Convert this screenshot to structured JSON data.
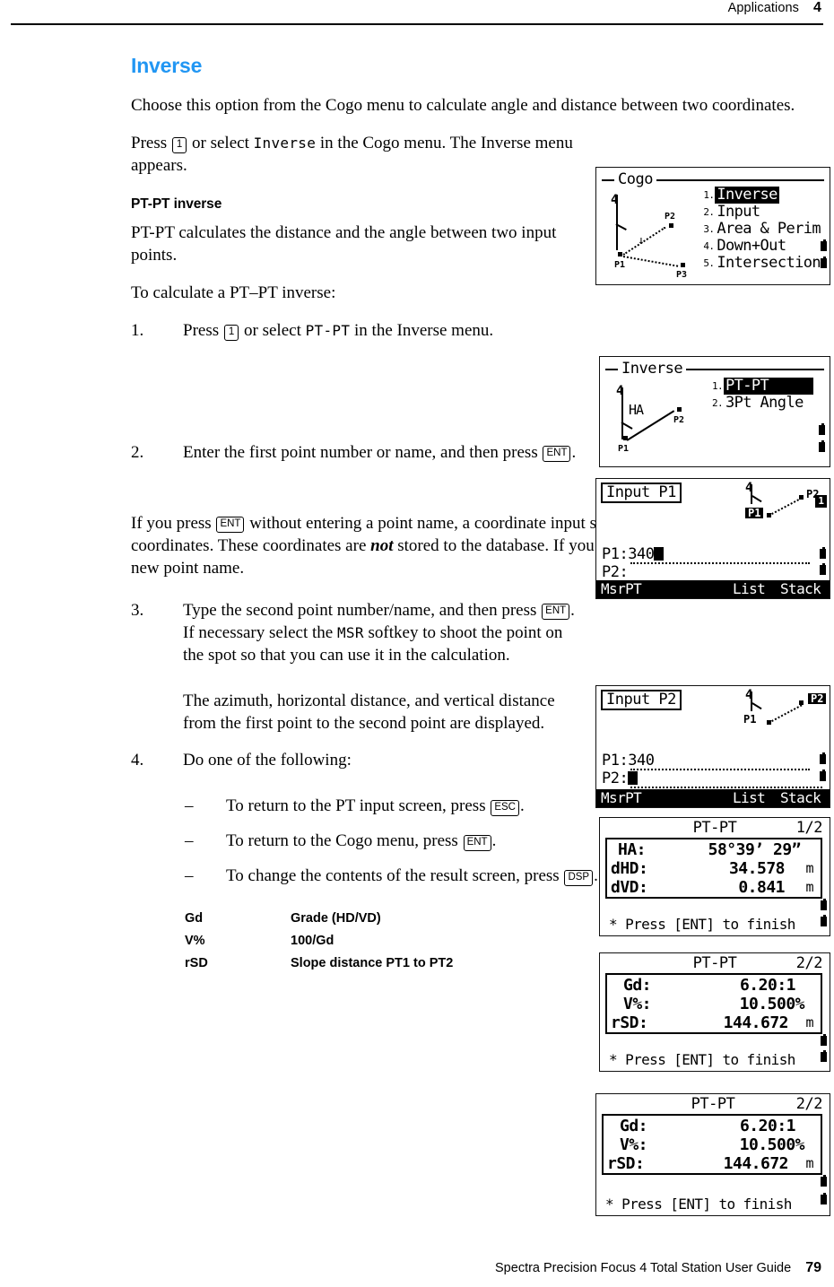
{
  "header": {
    "section": "Applications",
    "chapter": "4"
  },
  "footer": {
    "guide": "Spectra Precision Focus 4 Total Station User Guide",
    "page": "79"
  },
  "content": {
    "section_title": "Inverse",
    "intro": "Choose this option from the Cogo menu to calculate angle and distance between two coordinates.",
    "press_para_pre": "Press ",
    "press_para_key": "1",
    "press_para_mid": " or select ",
    "press_para_mono": "Inverse",
    "press_para_post": " in the Cogo menu. The Inverse menu appears.",
    "subsection_title": "PT-PT inverse",
    "ptpt_desc": "PT-PT calculates the distance and the angle between two input points.",
    "to_calc": "To calculate a PT–PT inverse:",
    "steps": [
      {
        "num": "1.",
        "pre": "Press ",
        "key": "1",
        "mid": " or select ",
        "mono": "PT-PT",
        "post": " in the Inverse menu."
      },
      {
        "num": "2.",
        "pre": "Enter the first point number or name, and then press ",
        "key": "ENT",
        "post": "."
      },
      {
        "num": "3.",
        "pre": "Type the second point number/name, and then press ",
        "key": "ENT",
        "mid": ". If necessary select the ",
        "mono": "MSR",
        "post": " softkey to shoot the point on the spot so that you can use it in the calculation."
      },
      {
        "num": "4.",
        "pre": "Do one of the following:"
      }
    ],
    "note_pre": "If you press ",
    "note_key": "ENT",
    "note_mid": " without entering a point name, a coordinate input screen appears, and you can enter coordinates. These coordinates are ",
    "note_bold": "not",
    "note_post": " stored to the database. If you want to store the point, specify a new point name.",
    "azimuth_note": "The azimuth, horizontal distance, and vertical distance from the first point to the second point are displayed.",
    "bullets": [
      {
        "dash": "–",
        "pre": "To return to the PT input screen, press ",
        "key": "ESC",
        "post": "."
      },
      {
        "dash": "–",
        "pre": "To return to the Cogo menu, press ",
        "key": "ENT",
        "post": "."
      },
      {
        "dash": "–",
        "pre": "To change the contents of the result screen, press ",
        "key": "DSP",
        "post": "."
      }
    ],
    "definitions": [
      {
        "term": "Gd",
        "desc": "Grade (HD/VD)"
      },
      {
        "term": "V%",
        "desc": "100/Gd"
      },
      {
        "term": "rSD",
        "desc": "Slope distance PT1 to PT2"
      }
    ]
  },
  "screens": {
    "cogo": {
      "frame_label": "Cogo",
      "items": [
        {
          "index": "1.",
          "label": "Inverse",
          "selected": true
        },
        {
          "index": "2.",
          "label": "Input",
          "selected": false
        },
        {
          "index": "3.",
          "label": "Area & Perim",
          "selected": false
        },
        {
          "index": "4.",
          "label": "Down+Out",
          "selected": false
        },
        {
          "index": "5.",
          "label": "Intersection",
          "selected": false
        }
      ],
      "diagram_points": [
        "P1",
        "P2",
        "P3"
      ]
    },
    "inverse": {
      "frame_label": "Inverse",
      "items": [
        {
          "index": "1.",
          "label": "PT-PT",
          "selected": true
        },
        {
          "index": "2.",
          "label": "3Pt Angle",
          "selected": false
        }
      ],
      "diagram_points": [
        "P1",
        "P2"
      ],
      "diagram_angle_label": "HA"
    },
    "input_p1": {
      "title": "Input P1",
      "rows": [
        {
          "label": "P1:",
          "value": "340",
          "cursor": true
        },
        {
          "label": "P2:",
          "value": "",
          "cursor": false
        }
      ],
      "softkeys": [
        "MsrPT",
        "List",
        "Stack"
      ],
      "diagram_points": [
        "P1",
        "P2"
      ],
      "mode_indicator": "1"
    },
    "input_p2": {
      "title": "Input P2",
      "rows": [
        {
          "label": "P1:",
          "value": "340",
          "cursor": false
        },
        {
          "label": "P2:",
          "value": "",
          "cursor": true
        }
      ],
      "softkeys": [
        "MsrPT",
        "List",
        "Stack"
      ],
      "diagram_points": [
        "P1",
        "P2"
      ]
    },
    "result_1": {
      "title": "PT-PT",
      "page": "1/2",
      "rows": [
        {
          "key": "HA:",
          "value": "58°39’ 29”",
          "unit": ""
        },
        {
          "key": "dHD:",
          "value": "34.578",
          "unit": "m"
        },
        {
          "key": "dVD:",
          "value": "0.841",
          "unit": "m"
        }
      ],
      "footer": "* Press [ENT] to finish"
    },
    "result_2": {
      "title": "PT-PT",
      "page": "2/2",
      "rows": [
        {
          "key": "Gd:",
          "value": "6.20:1",
          "unit": ""
        },
        {
          "key": "V%:",
          "value": "10.500%",
          "unit": ""
        },
        {
          "key": "rSD:",
          "value": "144.672",
          "unit": "m"
        }
      ],
      "footer": "* Press [ENT] to finish"
    },
    "result_3": {
      "title": "PT-PT",
      "page": "2/2",
      "rows": [
        {
          "key": "Gd:",
          "value": "6.20:1",
          "unit": ""
        },
        {
          "key": "V%:",
          "value": "10.500%",
          "unit": ""
        },
        {
          "key": "rSD:",
          "value": "144.672",
          "unit": "m"
        }
      ],
      "footer": "* Press [ENT] to finish"
    }
  }
}
